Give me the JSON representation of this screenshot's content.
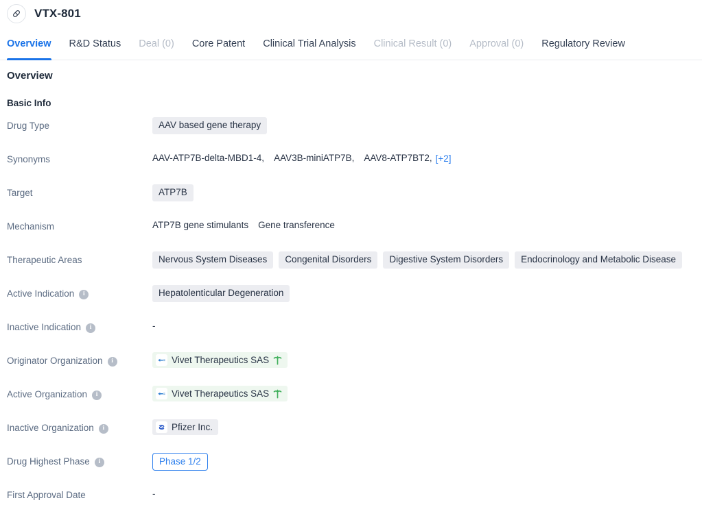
{
  "header": {
    "icon": "capsule-pill-icon",
    "title": "VTX-801"
  },
  "tabs": [
    {
      "label": "Overview",
      "state": "active"
    },
    {
      "label": "R&D Status",
      "state": "normal"
    },
    {
      "label": "Deal (0)",
      "state": "disabled"
    },
    {
      "label": "Core Patent",
      "state": "normal"
    },
    {
      "label": "Clinical Trial Analysis",
      "state": "normal"
    },
    {
      "label": "Clinical Result (0)",
      "state": "disabled"
    },
    {
      "label": "Approval (0)",
      "state": "disabled"
    },
    {
      "label": "Regulatory Review",
      "state": "normal"
    }
  ],
  "overview": {
    "section_title": "Overview",
    "sub_title": "Basic Info",
    "rows": {
      "drug_type": {
        "label": "Drug Type",
        "tags": [
          "AAV based gene therapy"
        ]
      },
      "synonyms": {
        "label": "Synonyms",
        "values": [
          "AAV-ATP7B-delta-MBD1-4,",
          "AAV3B-miniATP7B,",
          "AAV8-ATP7BT2,"
        ],
        "more": "[+2]"
      },
      "target": {
        "label": "Target",
        "tags": [
          "ATP7B"
        ]
      },
      "mechanism": {
        "label": "Mechanism",
        "values": [
          "ATP7B gene stimulants",
          "Gene transference"
        ]
      },
      "therapeutic_areas": {
        "label": "Therapeutic Areas",
        "tags": [
          "Nervous System Diseases",
          "Congenital Disorders",
          "Digestive System Disorders",
          "Endocrinology and Metabolic Disease"
        ]
      },
      "active_indication": {
        "label": "Active Indication",
        "info": true,
        "tags": [
          "Hepatolenticular Degeneration"
        ]
      },
      "inactive_indication": {
        "label": "Inactive Indication",
        "info": true,
        "empty": "-"
      },
      "originator_organization": {
        "label": "Originator Organization",
        "info": true,
        "orgs": [
          {
            "name": "Vivet Therapeutics SAS",
            "logo": "vivet-logo-icon",
            "marker": "tree-icon",
            "style": "green"
          }
        ]
      },
      "active_organization": {
        "label": "Active Organization",
        "info": true,
        "orgs": [
          {
            "name": "Vivet Therapeutics SAS",
            "logo": "vivet-logo-icon",
            "marker": "tree-icon",
            "style": "green"
          }
        ]
      },
      "inactive_organization": {
        "label": "Inactive Organization",
        "info": true,
        "orgs": [
          {
            "name": "Pfizer Inc.",
            "logo": "pfizer-logo-icon",
            "marker": "",
            "style": "gray"
          }
        ]
      },
      "drug_highest_phase": {
        "label": "Drug Highest Phase",
        "info": true,
        "phase": "Phase 1/2"
      },
      "first_approval_date": {
        "label": "First Approval Date",
        "empty": "-"
      }
    }
  },
  "colors": {
    "accent_blue": "#1a73e8",
    "link_blue": "#2f80ed",
    "tag_gray_bg": "#ecedf1",
    "org_green_bg": "#eef7ef",
    "label_gray": "#5b6b82",
    "text_dark": "#1d2939",
    "disabled_gray": "#b5bcc7",
    "tree_green": "#3faf5a"
  }
}
